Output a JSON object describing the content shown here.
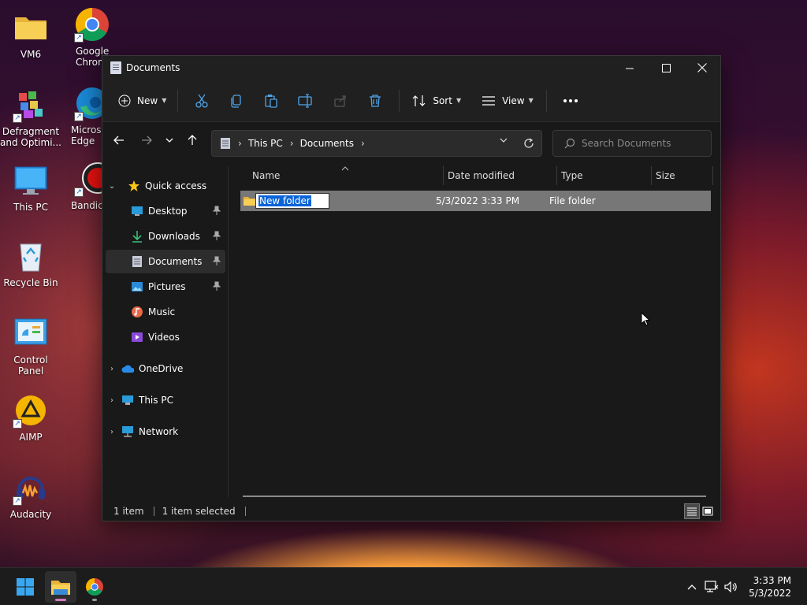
{
  "desktop": {
    "icons": [
      {
        "label": "VM6",
        "icon": "folder-icon"
      },
      {
        "label": "Google Chrome",
        "icon": "chrome-icon"
      },
      {
        "label": "Defragment and Optimi...",
        "icon": "defrag-icon"
      },
      {
        "label": "Microsoft Edge",
        "icon": "edge-icon"
      },
      {
        "label": "This PC",
        "icon": "monitor-icon"
      },
      {
        "label": "Bandicam",
        "icon": "bandicam-icon"
      },
      {
        "label": "Recycle Bin",
        "icon": "recycle-bin-icon"
      },
      {
        "label": "Control Panel",
        "icon": "control-panel-icon"
      },
      {
        "label": "AIMP",
        "icon": "aimp-icon"
      },
      {
        "label": "Audacity",
        "icon": "audacity-icon"
      }
    ]
  },
  "window": {
    "title": "Documents",
    "toolbar": {
      "new_label": "New",
      "sort_label": "Sort",
      "view_label": "View"
    },
    "address": {
      "crumbs": [
        "This PC",
        "Documents"
      ]
    },
    "search": {
      "placeholder": "Search Documents"
    },
    "nav": {
      "quick_access": "Quick access",
      "items": [
        {
          "label": "Desktop",
          "icon": "desktop-icon",
          "pinned": true
        },
        {
          "label": "Downloads",
          "icon": "download-icon",
          "pinned": true
        },
        {
          "label": "Documents",
          "icon": "document-icon",
          "pinned": true,
          "selected": true
        },
        {
          "label": "Pictures",
          "icon": "pictures-icon",
          "pinned": true
        },
        {
          "label": "Music",
          "icon": "music-icon",
          "pinned": false
        },
        {
          "label": "Videos",
          "icon": "videos-icon",
          "pinned": false
        }
      ],
      "onedrive": "OneDrive",
      "this_pc": "This PC",
      "network": "Network"
    },
    "columns": [
      "Name",
      "Date modified",
      "Type",
      "Size"
    ],
    "rows": [
      {
        "name": "New folder",
        "date": "5/3/2022 3:33 PM",
        "type": "File folder",
        "size": ""
      }
    ],
    "status": {
      "count": "1 item",
      "selected": "1 item selected"
    }
  },
  "taskbar": {
    "time": "3:33 PM",
    "date": "5/3/2022"
  },
  "colors": {
    "accent": "#0a64d8",
    "window_bg": "#191919",
    "selection": "#777777"
  }
}
